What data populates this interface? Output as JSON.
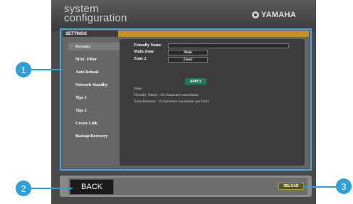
{
  "app": {
    "title_line1": "system",
    "title_line2": "configuration",
    "brand": "YAMAHA"
  },
  "settings": {
    "tab_label": "SETTINGS"
  },
  "menu": {
    "items": [
      "Rename",
      "MAC Filter",
      "Auto Reload",
      "Network Standby",
      "Tips 1",
      "Tips 2",
      "Create Link",
      "Backup/Recovery"
    ]
  },
  "rename": {
    "friendly_name_label": "Friendly Name",
    "friendly_name_value": "",
    "main_zone_label": "Main Zone",
    "main_zone_value": "Main",
    "zone2_label": "Zone 2",
    "zone2_value": "Zone2",
    "apply_label": "APPLY",
    "note_title": "Note:",
    "note_line1": "Friendly Name : 30 characters maximum.",
    "note_line2": "Zone Rename : 9 characters maximum per field."
  },
  "bottom": {
    "back_label": "BACK",
    "reload_label": "RELOAD"
  },
  "callouts": [
    "1",
    "2",
    "3"
  ],
  "colors": {
    "accent_blue": "#2e9fd7",
    "tab_gold": "#c8911c",
    "apply_green": "#1e7a5a"
  }
}
